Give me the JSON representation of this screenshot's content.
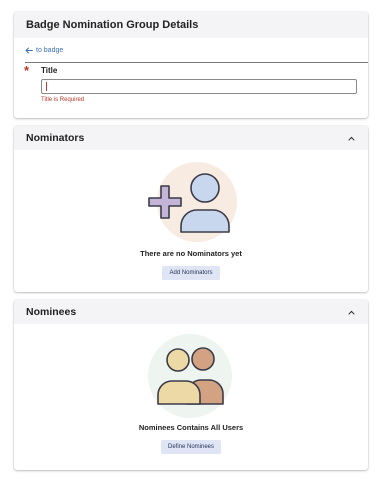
{
  "details": {
    "header_title": "Badge Nomination Group Details",
    "back_label": "to badge",
    "required_mark": "*",
    "title_label": "Title",
    "title_value": "",
    "error_text": "Title is Required"
  },
  "nominators": {
    "header_title": "Nominators",
    "empty_text": "There are no Nominators yet",
    "button_label": "Add Nominators",
    "icon": "add-user-icon"
  },
  "nominees": {
    "header_title": "Nominees",
    "empty_text": "Nominees Contains All Users",
    "button_label": "Define Nominees",
    "icon": "users-group-icon"
  },
  "colors": {
    "link": "#3d6fb6",
    "error": "#c0392b",
    "header_bg": "#f4f4f6",
    "button_bg": "#dfe5f4",
    "add_user_circle": "#f7ebe2",
    "add_user_plus": "#c4b4d8",
    "add_user_person": "#c9d7ee",
    "group_circle": "#eef5f1",
    "group_person_front": "#ecd9a6",
    "group_person_back": "#d2a283"
  }
}
